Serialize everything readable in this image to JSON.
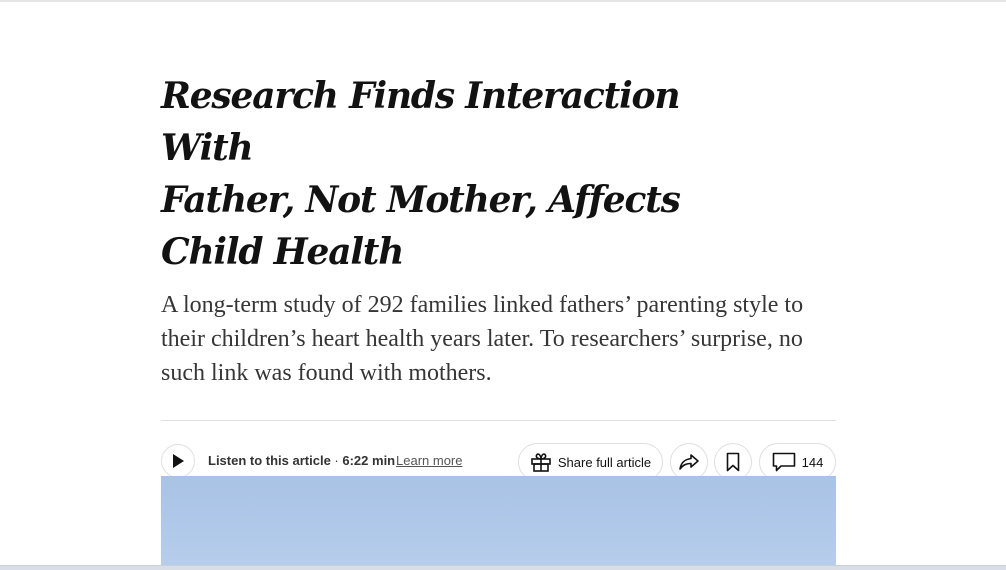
{
  "article": {
    "headline_lines": [
      "Research Finds Interaction With",
      "Father, Not Mother, Affects",
      "Child Health"
    ],
    "summary": "A long-term study of 292 families linked fathers’ parenting style to their children’s heart health years later. To researchers’ surprise, no such link was found with mothers."
  },
  "toolbar": {
    "listen_label": "Listen to this article",
    "listen_separator": " · ",
    "duration": "6:22 min",
    "learn_more": "Learn more",
    "share_full_label": "Share full article",
    "comments_count": "144"
  },
  "icons": {
    "play": "play-icon",
    "gift": "gift-icon",
    "share": "share-arrow-icon",
    "bookmark": "bookmark-icon",
    "comment": "comment-bubble-icon"
  },
  "colors": {
    "headline": "#121212",
    "summary": "#363636",
    "image_sky": "#b0c8e8"
  }
}
